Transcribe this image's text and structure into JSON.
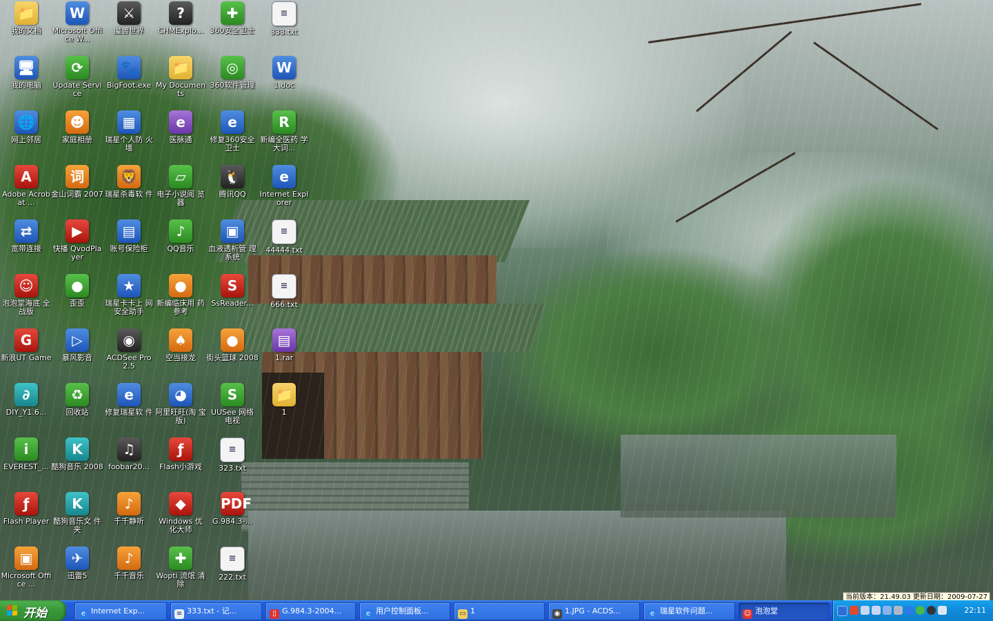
{
  "desktop": {
    "icons": [
      {
        "label": "我的文档",
        "glyph": "📁",
        "style": "g-folder",
        "col": 0,
        "row": 0
      },
      {
        "label": "我的电脑",
        "glyph": "🖥",
        "style": "g-blue",
        "col": 0,
        "row": 1
      },
      {
        "label": "网上邻居",
        "glyph": "🌐",
        "style": "g-blue",
        "col": 0,
        "row": 2
      },
      {
        "label": "Adobe Acrobat ...",
        "glyph": "A",
        "style": "g-red",
        "col": 0,
        "row": 3
      },
      {
        "label": "宽带连接",
        "glyph": "⇄",
        "style": "g-blue",
        "col": 0,
        "row": 4
      },
      {
        "label": "泡泡堂海底 全战版",
        "glyph": "☺",
        "style": "g-red",
        "col": 0,
        "row": 5
      },
      {
        "label": "新浪UT Game",
        "glyph": "G",
        "style": "g-red",
        "col": 0,
        "row": 6
      },
      {
        "label": "DIY_Y1.6...",
        "glyph": "∂",
        "style": "g-teal",
        "col": 0,
        "row": 7
      },
      {
        "label": "EVEREST_...",
        "glyph": "i",
        "style": "g-green",
        "col": 0,
        "row": 8
      },
      {
        "label": "Flash Player",
        "glyph": "ƒ",
        "style": "g-red",
        "col": 0,
        "row": 9
      },
      {
        "label": "Microsoft Office ...",
        "glyph": "▣",
        "style": "g-orange",
        "col": 0,
        "row": 10
      },
      {
        "label": "Microsoft Office W...",
        "glyph": "W",
        "style": "g-blue",
        "col": 1,
        "row": 0
      },
      {
        "label": "Update Service",
        "glyph": "⟳",
        "style": "g-green",
        "col": 1,
        "row": 1
      },
      {
        "label": "家庭相册",
        "glyph": "☻",
        "style": "g-orange",
        "col": 1,
        "row": 2
      },
      {
        "label": "金山词霸 2007",
        "glyph": "词",
        "style": "g-orange",
        "col": 1,
        "row": 3
      },
      {
        "label": "快播 QvodPlayer",
        "glyph": "▶",
        "style": "g-red",
        "col": 1,
        "row": 4
      },
      {
        "label": "歪歪",
        "glyph": "●",
        "style": "g-green",
        "col": 1,
        "row": 5
      },
      {
        "label": "暴风影音",
        "glyph": "▷",
        "style": "g-blue",
        "col": 1,
        "row": 6
      },
      {
        "label": "回收站",
        "glyph": "♻",
        "style": "g-green",
        "col": 1,
        "row": 7
      },
      {
        "label": "酷狗音乐 2008",
        "glyph": "K",
        "style": "g-teal",
        "col": 1,
        "row": 8
      },
      {
        "label": "酷狗音乐文 件夹",
        "glyph": "K",
        "style": "g-teal",
        "col": 1,
        "row": 9
      },
      {
        "label": "迅雷5",
        "glyph": "✈",
        "style": "g-blue",
        "col": 1,
        "row": 10
      },
      {
        "label": "魔兽世界",
        "glyph": "⚔",
        "style": "g-dark",
        "col": 2,
        "row": 0
      },
      {
        "label": "BigFoot.exe",
        "glyph": "🐾",
        "style": "g-blue",
        "col": 2,
        "row": 1
      },
      {
        "label": "瑞星个人防 火墙",
        "glyph": "▦",
        "style": "g-blue",
        "col": 2,
        "row": 2
      },
      {
        "label": "瑞星杀毒软 件",
        "glyph": "🦁",
        "style": "g-orange",
        "col": 2,
        "row": 3
      },
      {
        "label": "账号保险柜",
        "glyph": "▤",
        "style": "g-blue",
        "col": 2,
        "row": 4
      },
      {
        "label": "瑞星卡卡上 网安全助手",
        "glyph": "★",
        "style": "g-blue",
        "col": 2,
        "row": 5
      },
      {
        "label": "ACDSee Pro 2.5",
        "glyph": "◉",
        "style": "g-dark",
        "col": 2,
        "row": 6
      },
      {
        "label": "修复瑞星软 件",
        "glyph": "e",
        "style": "g-blue",
        "col": 2,
        "row": 7
      },
      {
        "label": "foobar20...",
        "glyph": "♫",
        "style": "g-dark",
        "col": 2,
        "row": 8
      },
      {
        "label": "千千静听",
        "glyph": "♪",
        "style": "g-orange",
        "col": 2,
        "row": 9
      },
      {
        "label": "千千音乐",
        "glyph": "♪",
        "style": "g-orange",
        "col": 2,
        "row": 10
      },
      {
        "label": "CHMExplo...",
        "glyph": "?",
        "style": "g-dark",
        "col": 3,
        "row": 0
      },
      {
        "label": "My Documents",
        "glyph": "📁",
        "style": "g-folder",
        "col": 3,
        "row": 1
      },
      {
        "label": "医脉通",
        "glyph": "e",
        "style": "g-purple",
        "col": 3,
        "row": 2
      },
      {
        "label": "电子小说阅 览器",
        "glyph": "▱",
        "style": "g-green",
        "col": 3,
        "row": 3
      },
      {
        "label": "QQ音乐",
        "glyph": "♪",
        "style": "g-green",
        "col": 3,
        "row": 4
      },
      {
        "label": "新编临床用 药参考",
        "glyph": "●",
        "style": "g-orange",
        "col": 3,
        "row": 5
      },
      {
        "label": "空当接龙",
        "glyph": "♠",
        "style": "g-orange",
        "col": 3,
        "row": 6
      },
      {
        "label": "阿里旺旺(淘 宝版)",
        "glyph": "◕",
        "style": "g-blue",
        "col": 3,
        "row": 7
      },
      {
        "label": "Flash小游戏",
        "glyph": "ƒ",
        "style": "g-red",
        "col": 3,
        "row": 8
      },
      {
        "label": "Windows 优 化大师",
        "glyph": "◆",
        "style": "g-red",
        "col": 3,
        "row": 9
      },
      {
        "label": "Wopti 流氓 清除",
        "glyph": "✚",
        "style": "g-green",
        "col": 3,
        "row": 10
      },
      {
        "label": "360安全卫士",
        "glyph": "✚",
        "style": "g-green",
        "col": 4,
        "row": 0
      },
      {
        "label": "360软件管理",
        "glyph": "◎",
        "style": "g-green",
        "col": 4,
        "row": 1
      },
      {
        "label": "修复360安全 卫士",
        "glyph": "e",
        "style": "g-blue",
        "col": 4,
        "row": 2
      },
      {
        "label": "腾讯QQ",
        "glyph": "🐧",
        "style": "g-dark",
        "col": 4,
        "row": 3
      },
      {
        "label": "血液透析管 理系统",
        "glyph": "▣",
        "style": "g-blue",
        "col": 4,
        "row": 4
      },
      {
        "label": "SsReader...",
        "glyph": "S",
        "style": "g-red",
        "col": 4,
        "row": 5
      },
      {
        "label": "街头篮球 2008",
        "glyph": "●",
        "style": "g-orange",
        "col": 4,
        "row": 6
      },
      {
        "label": "UUSee 网络 电视",
        "glyph": "S",
        "style": "g-green",
        "col": 4,
        "row": 7
      },
      {
        "label": "323.txt",
        "glyph": "≡",
        "style": "g-txt",
        "col": 4,
        "row": 8
      },
      {
        "label": "G.984.3-...",
        "glyph": "PDF",
        "style": "g-red",
        "col": 4,
        "row": 9
      },
      {
        "label": "222.txt",
        "glyph": "≡",
        "style": "g-txt",
        "col": 4,
        "row": 10
      },
      {
        "label": "333.txt",
        "glyph": "≡",
        "style": "g-txt",
        "col": 5,
        "row": 0
      },
      {
        "label": "1.doc",
        "glyph": "W",
        "style": "g-blue",
        "col": 5,
        "row": 1
      },
      {
        "label": "新编全医药 学大词...",
        "glyph": "R",
        "style": "g-green",
        "col": 5,
        "row": 2
      },
      {
        "label": "Internet Explorer",
        "glyph": "e",
        "style": "g-blue",
        "col": 5,
        "row": 3
      },
      {
        "label": "44444.txt",
        "glyph": "≡",
        "style": "g-txt",
        "col": 5,
        "row": 4
      },
      {
        "label": "666.txt",
        "glyph": "≡",
        "style": "g-txt",
        "col": 5,
        "row": 5
      },
      {
        "label": "1.rar",
        "glyph": "▤",
        "style": "g-purple",
        "col": 5,
        "row": 6
      },
      {
        "label": "1",
        "glyph": "📁",
        "style": "g-folder",
        "col": 5,
        "row": 7
      }
    ]
  },
  "version_info": "当前版本：21.49.03 更新日期：2009-07-27",
  "taskbar": {
    "start_label": "开始",
    "tasks": [
      {
        "label": "Internet Exp...",
        "icon": "e",
        "icon_bg": "#2b7be8",
        "active": false
      },
      {
        "label": "333.txt - 记...",
        "icon": "≡",
        "icon_bg": "#e8eef8",
        "active": false
      },
      {
        "label": "G.984.3-2004...",
        "icon": "▯",
        "icon_bg": "#d33",
        "active": false
      },
      {
        "label": "用户控制面板...",
        "icon": "e",
        "icon_bg": "#2b7be8",
        "active": false
      },
      {
        "label": "1",
        "icon": "▭",
        "icon_bg": "#f2cd5c",
        "active": false
      },
      {
        "label": "1.JPG - ACDS...",
        "icon": "◉",
        "icon_bg": "#444",
        "active": false
      },
      {
        "label": "瑞星软件问题...",
        "icon": "e",
        "icon_bg": "#2b7be8",
        "active": false
      },
      {
        "label": "泡泡堂",
        "icon": "☺",
        "icon_bg": "#d33",
        "active": true
      }
    ],
    "clock": "22:11"
  }
}
